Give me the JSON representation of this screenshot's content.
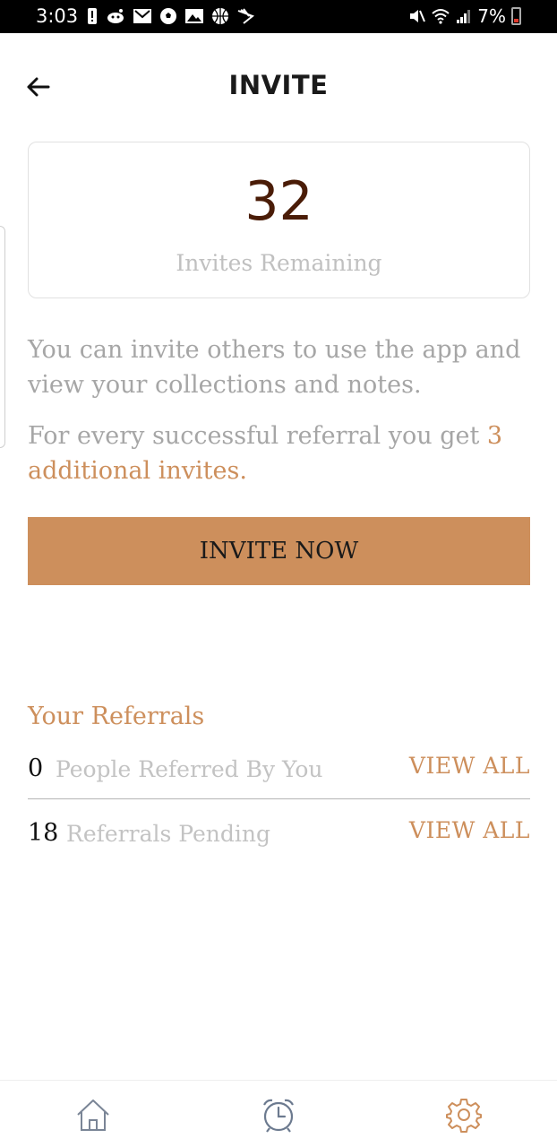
{
  "status_bar": {
    "time": "3:03",
    "battery": "7%",
    "left_icons": [
      "alert-icon",
      "reddit-icon",
      "gmail-icon",
      "soccer-icon",
      "gallery-icon",
      "basketball-icon",
      "sprint-icon"
    ],
    "right_icons": [
      "mute-icon",
      "wifi-icon",
      "signal-icon",
      "battery-icon"
    ]
  },
  "header": {
    "title": "INVITE",
    "back_icon": "arrow-left-icon"
  },
  "invites_card": {
    "count": "32",
    "label": "Invites Remaining"
  },
  "description": {
    "paragraph1": "You can invite others to use the app and view your collections and notes.",
    "paragraph2_prefix": "For every successful referral you get ",
    "paragraph2_highlight": "3 additional invites."
  },
  "invite_button": {
    "label": "INVITE NOW"
  },
  "referrals": {
    "title": "Your Referrals",
    "rows": [
      {
        "count": "0",
        "label": "People Referred By You",
        "action": "VIEW ALL"
      },
      {
        "count": "18",
        "label": "Referrals Pending",
        "action": "VIEW ALL"
      }
    ]
  },
  "bottom_nav": {
    "items": [
      {
        "icon": "home-icon",
        "color": "#7a8596"
      },
      {
        "icon": "alarm-clock-icon",
        "color": "#6c7a8f"
      },
      {
        "icon": "gear-icon",
        "color": "#cd8f5c"
      }
    ]
  },
  "colors": {
    "accent": "#cd8f5c",
    "count": "#4a1c07",
    "muted_text": "#a6a6a6"
  }
}
